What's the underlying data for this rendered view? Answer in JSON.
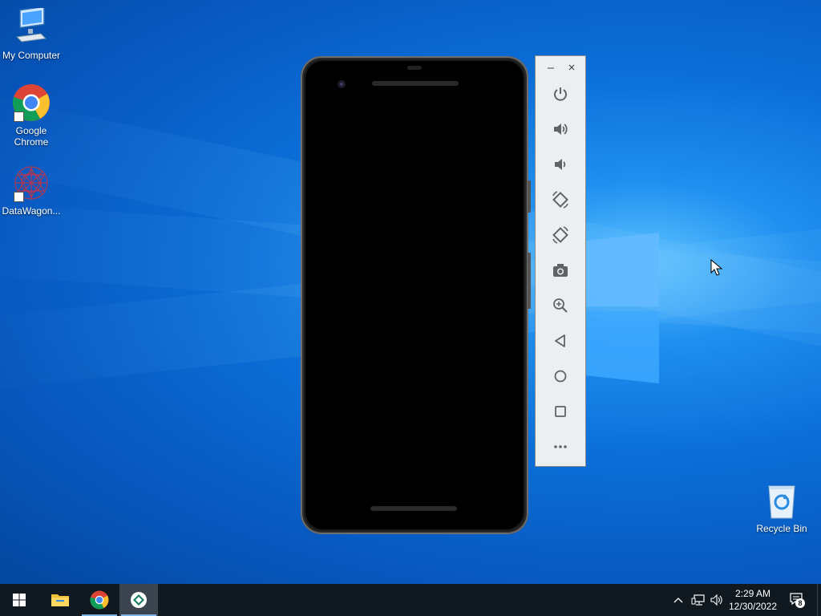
{
  "desktop": {
    "icons": [
      {
        "label": "My Computer"
      },
      {
        "label": "Google Chrome"
      },
      {
        "label": "DataWagon..."
      },
      {
        "label": "Recycle Bin"
      }
    ]
  },
  "emulator": {
    "toolbar": {
      "buttons": [
        {
          "icon": "power-icon"
        },
        {
          "icon": "volume-up-icon"
        },
        {
          "icon": "volume-down-icon"
        },
        {
          "icon": "rotate-left-icon"
        },
        {
          "icon": "rotate-right-icon"
        },
        {
          "icon": "camera-icon"
        },
        {
          "icon": "zoom-icon"
        },
        {
          "icon": "back-icon"
        },
        {
          "icon": "home-icon"
        },
        {
          "icon": "overview-icon"
        },
        {
          "icon": "more-icon"
        }
      ]
    }
  },
  "taskbar": {
    "clock": {
      "time": "2:29 AM",
      "date": "12/30/2022"
    },
    "notification_count": "8"
  },
  "colors": {
    "desktop_blue": "#0b6fd8",
    "taskbar": "#101820",
    "toolbar_bg": "#eceff1",
    "icon_gray": "#5f6368"
  }
}
